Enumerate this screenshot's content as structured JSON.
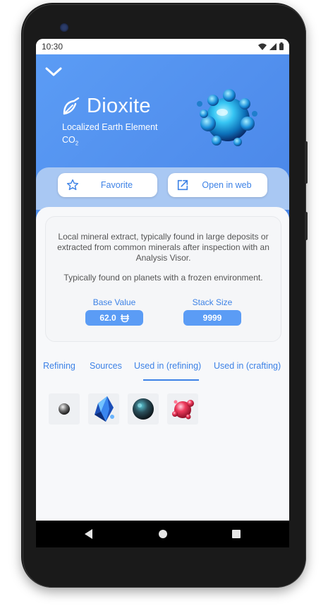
{
  "status_bar": {
    "time": "10:30"
  },
  "header": {
    "title": "Dioxite",
    "subtitle": "Localized Earth Element",
    "formula_main": "CO",
    "formula_sub": "2"
  },
  "actions": {
    "favorite_label": "Favorite",
    "open_web_label": "Open in web"
  },
  "description": {
    "text": "Local mineral extract, typically found in large deposits or extracted from common minerals after inspection with an Analysis Visor.",
    "found_on": "Typically found on planets with a frozen environment."
  },
  "stats": {
    "base_value_label": "Base Value",
    "base_value": "62.0",
    "stack_size_label": "Stack Size",
    "stack_size": "9999"
  },
  "tabs": [
    {
      "label": "Refining"
    },
    {
      "label": "Sources"
    },
    {
      "label": "Used in (refining)",
      "selected": true
    },
    {
      "label": "Used in (crafting)"
    }
  ],
  "items": [
    {
      "icon": "grey-sphere-icon"
    },
    {
      "icon": "blue-crystal-icon"
    },
    {
      "icon": "dark-orb-icon"
    },
    {
      "icon": "red-molecule-icon"
    }
  ],
  "colors": {
    "header_bg": "#5b9cf5",
    "accent": "#3d82e6",
    "button_strip": "#a9c8f3"
  }
}
